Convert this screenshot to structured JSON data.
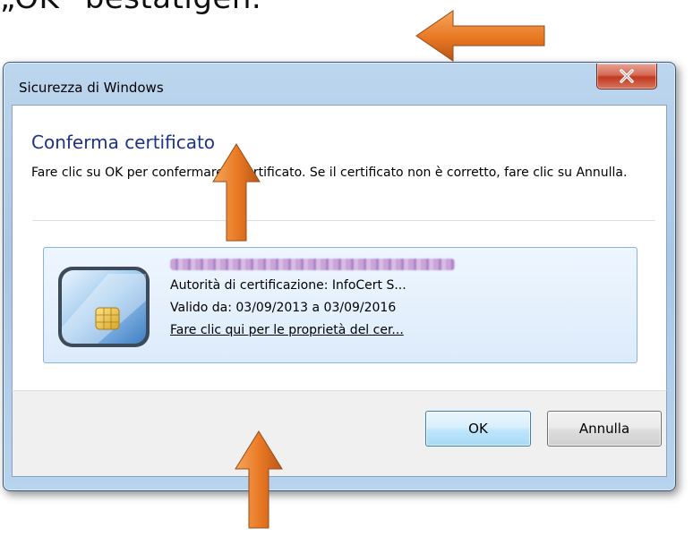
{
  "caption": "„OK“ bestätigen.",
  "window": {
    "title": "Sicurezza di Windows",
    "close_label": "X"
  },
  "dialog": {
    "heading": "Conferma certificato",
    "message": "Fare clic su OK per confermare il certificato. Se il certificato non è corretto, fare clic su Annulla."
  },
  "certificate": {
    "issuer": "Autorità di certificazione: InfoCert S...",
    "validity": "Valido da: 03/09/2013 a 03/09/2016",
    "properties_link": "Fare clic qui per le proprietà del cer..."
  },
  "buttons": {
    "ok": "OK",
    "cancel": "Annulla"
  },
  "annotation_arrows": [
    {
      "direction": "left",
      "color": "#e87722"
    },
    {
      "direction": "up",
      "color": "#e87722"
    },
    {
      "direction": "up",
      "color": "#e87722"
    }
  ],
  "colors": {
    "heading": "#1e3287",
    "arrow": "#e87722",
    "close_button": "#c0391f"
  }
}
